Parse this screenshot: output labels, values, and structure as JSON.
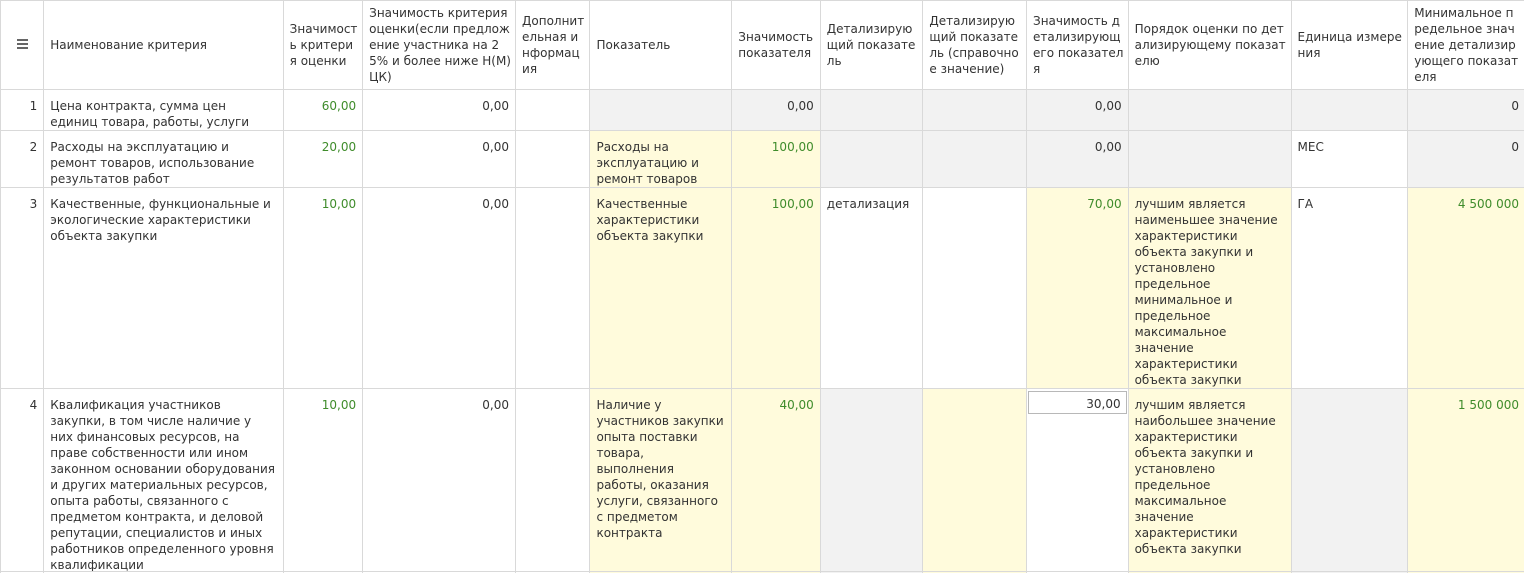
{
  "headers": {
    "menu_icon": "hamburger-menu-icon",
    "name": "Наименование критерия",
    "weight": "Значимость критерия оценки",
    "weight_reduced": "Значимость критерия оценки(если предложение участника на 25% и более ниже Н(М)ЦК)",
    "extra_info": "Дополнительная информация",
    "indicator": "Показатель",
    "indicator_weight": "Значимость показателя",
    "detail_indicator": "Детализирующий показатель",
    "detail_indicator_ref": "Детализирующий показатель (справочное значение)",
    "detail_weight": "Значимость детализирующего показателя",
    "detail_order": "Порядок оценки по детализирующему показателю",
    "unit": "Единица измерения",
    "min_value": "Минимальное предельное значение детализирующего показателя"
  },
  "rows": [
    {
      "index": "1",
      "name": "Цена контракта, сумма цен единиц товара, работы, услуги",
      "weight": "60,00",
      "weight_reduced": "0,00",
      "extra_info": "",
      "indicator": "",
      "indicator_weight": "0,00",
      "detail_indicator": "",
      "detail_indicator_ref": "",
      "detail_weight": "0,00",
      "detail_order": "",
      "unit": "",
      "min_value": "0"
    },
    {
      "index": "2",
      "name": "Расходы на эксплуатацию и ремонт товаров, использование результатов работ",
      "weight": "20,00",
      "weight_reduced": "0,00",
      "extra_info": "",
      "indicator": "Расходы на эксплуатацию и ремонт товаров",
      "indicator_weight": "100,00",
      "detail_indicator": "",
      "detail_indicator_ref": "",
      "detail_weight": "0,00",
      "detail_order": "",
      "unit": "МЕС",
      "min_value": "0"
    },
    {
      "index": "3",
      "name": "Качественные, функциональные и экологические характеристики объекта закупки",
      "weight": "10,00",
      "weight_reduced": "0,00",
      "extra_info": "",
      "indicator": "Качественные характеристики объекта закупки",
      "indicator_weight": "100,00",
      "detail_indicator": "детализация",
      "detail_indicator_ref": "",
      "detail_weight": "70,00",
      "detail_order": "лучшим является наименьшее значение характеристики объекта закупки и установлено предельное минимальное и предельное максимальное значение характеристики объекта закупки",
      "unit": "ГА",
      "min_value": "4 500 000"
    },
    {
      "index": "4",
      "name": "Квалификация участников закупки, в том числе наличие у них финансовых ресурсов, на праве собственности или ином законном основании оборудования и других материальных ресурсов, опыта работы, связанного с предметом контракта, и деловой репутации, специалистов и иных работников определенного уровня квалификации",
      "weight": "10,00",
      "weight_reduced": "0,00",
      "extra_info": "",
      "indicator": "Наличие у участников закупки опыта поставки товара, выполнения работы, оказания услуги, связанного с предметом контракта",
      "indicator_weight": "40,00",
      "detail_indicator": "",
      "detail_indicator_ref": "",
      "detail_weight": "30,00",
      "detail_order": "лучшим является наибольшее значение характеристики объекта закупки и установлено предельное максимальное значение характеристики объекта закупки",
      "unit": "",
      "min_value": "1 500 000"
    }
  ],
  "colors": {
    "grid_border": "#d9d9d9",
    "readonly_gray": "#f2f2f2",
    "editable_yellow": "#fffbdc",
    "value_green": "#3f8c2b"
  }
}
